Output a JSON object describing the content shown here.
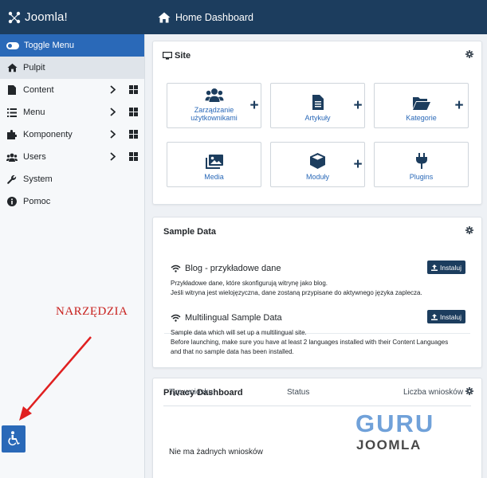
{
  "header": {
    "brand": "Joomla!",
    "title": "Home Dashboard"
  },
  "sidebar": {
    "toggle": "Toggle Menu",
    "items": [
      {
        "label": "Pulpit",
        "icon": "home-icon"
      },
      {
        "label": "Content",
        "icon": "file-icon"
      },
      {
        "label": "Menu",
        "icon": "list-icon"
      },
      {
        "label": "Komponenty",
        "icon": "puzzle-icon"
      },
      {
        "label": "Users",
        "icon": "users-icon"
      },
      {
        "label": "System",
        "icon": "wrench-icon"
      },
      {
        "label": "Pomoc",
        "icon": "info-icon"
      }
    ]
  },
  "annotation": {
    "text": "NARZĘDZIA",
    "color": "#c8201d"
  },
  "site": {
    "title": "Site",
    "tiles": [
      "Zarządzanie użytkownikami",
      "Artykuły",
      "Kategorie",
      "Media",
      "Moduły",
      "Plugins"
    ],
    "plus": "+"
  },
  "sample_data": {
    "title": "Sample Data",
    "install_label": "Instaluj",
    "items": [
      {
        "title": "Blog - przykładowe dane",
        "desc1": "Przykładowe dane, które skonfigurują witrynę jako blog.",
        "desc2": "Jeśli witryna jest wielojęzyczna, dane zostaną przypisane do aktywnego języka zaplecza."
      },
      {
        "title": "Multilingual Sample Data",
        "desc1": "Sample data which will set up a multilingual site.",
        "desc2": "Before launching, make sure you have at least 2 languages installed with their Content Languages",
        "desc3": "and that no sample data has been installed."
      }
    ]
  },
  "privacy": {
    "title": "Privacy Dashboard",
    "columns": [
      "Typ wniosku",
      "Status",
      "Liczba wniosków"
    ],
    "empty": "Nie ma żadnych wniosków"
  },
  "watermark": {
    "line1": "GURU",
    "line2": "JOOMLA"
  },
  "colors": {
    "header": "#1c3d5e",
    "accent": "#2a69b8",
    "annotation": "#c8201d"
  }
}
